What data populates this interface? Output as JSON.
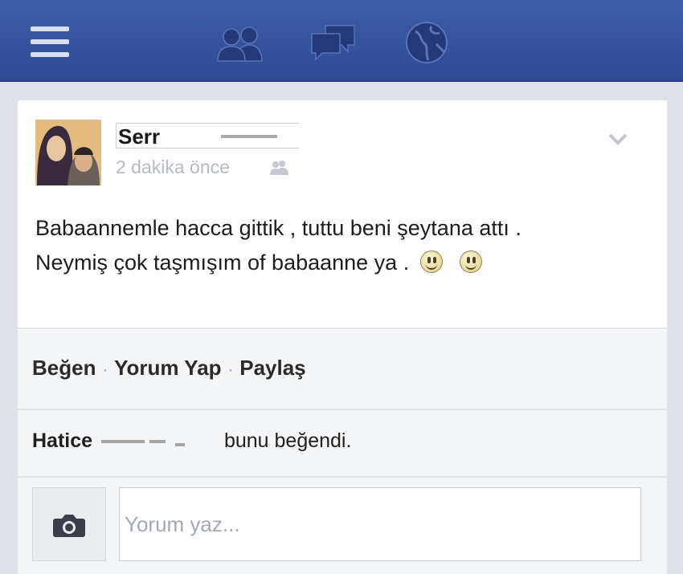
{
  "nav": {
    "icons": [
      "menu-icon",
      "friends-icon",
      "messages-icon",
      "globe-icon"
    ],
    "bar_color": "#3b5998"
  },
  "post": {
    "author": "Serr",
    "timestamp": "2 dakika önce",
    "text_line1": "Babaannemle hacca gittik , tuttu beni şeytana attı .",
    "text_line2": "Neymiş çok taşmışım of babaanne ya ."
  },
  "actions": {
    "like": "Beğen",
    "comment": "Yorum Yap",
    "share": "Paylaş",
    "separator": "·"
  },
  "likes": {
    "liker": "Hatice",
    "suffix": "bunu beğendi."
  },
  "comment": {
    "placeholder": "Yorum yaz..."
  }
}
